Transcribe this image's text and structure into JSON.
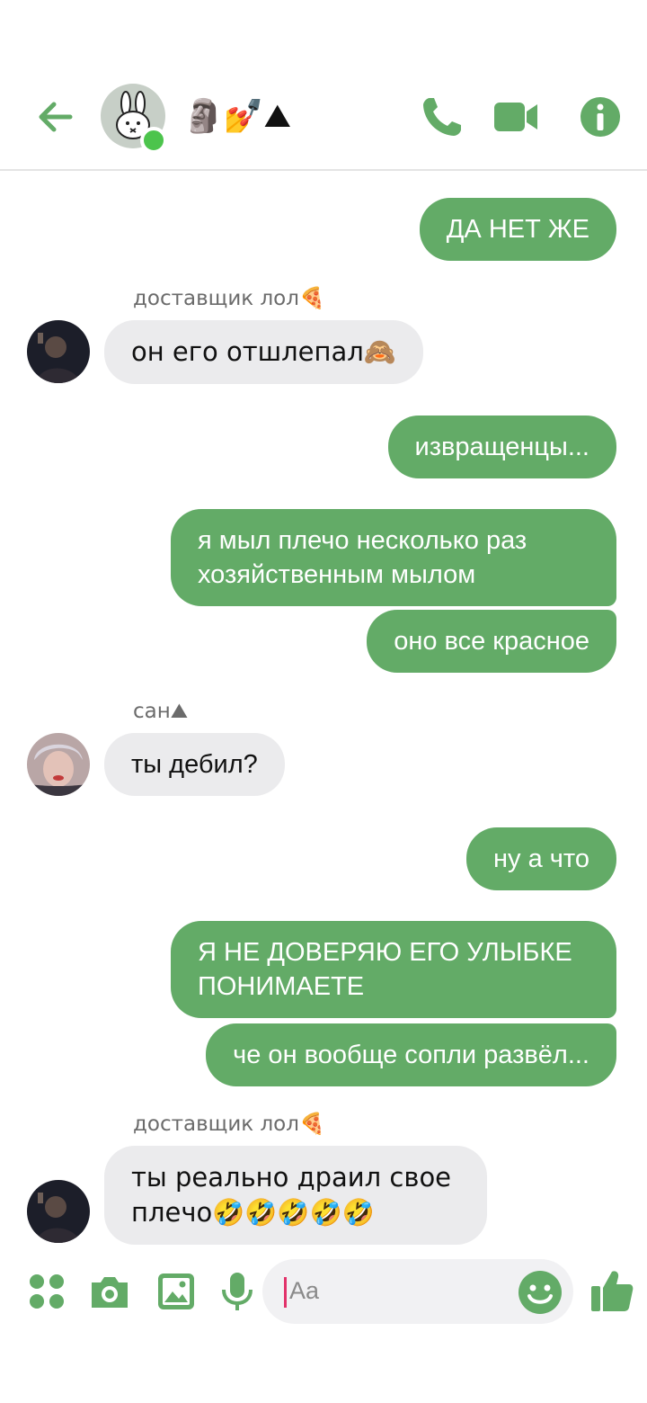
{
  "header": {
    "title_emojis": "🗿💅⛰",
    "icons": [
      "back-arrow-icon",
      "phone-icon",
      "video-camera-icon",
      "info-icon"
    ],
    "accent_color": "#63ab67"
  },
  "messages": [
    {
      "id": "m1",
      "side": "outgoing",
      "text": "ДА НЕТ ЖЕ"
    },
    {
      "id": "m2",
      "side": "incoming",
      "sender": "доставщик лол🍕",
      "text": "он его отшлепал🙈"
    },
    {
      "id": "m3",
      "side": "outgoing",
      "text": "извращенцы..."
    },
    {
      "id": "m4",
      "side": "outgoing",
      "text": "я мыл плечо несколько раз хозяйственным мылом"
    },
    {
      "id": "m5",
      "side": "outgoing",
      "text": "оно все красное"
    },
    {
      "id": "m6",
      "side": "incoming",
      "sender": "сан⛰",
      "text": "ты дебил?"
    },
    {
      "id": "m7",
      "side": "outgoing",
      "text": "ну а что"
    },
    {
      "id": "m8",
      "side": "outgoing",
      "text": "Я НЕ ДОВЕРЯЮ ЕГО УЛЫБКЕ ПОНИМАЕТЕ"
    },
    {
      "id": "m9",
      "side": "outgoing",
      "text": "че он вообще сопли развёл..."
    },
    {
      "id": "m10",
      "side": "incoming",
      "sender": "доставщик лол🍕",
      "text": "ты реально драил свое плечо🤣🤣🤣🤣🤣"
    }
  ],
  "composer": {
    "placeholder": "Aa",
    "icons": [
      "apps-grid-icon",
      "camera-icon",
      "image-icon",
      "microphone-icon",
      "emoji-icon",
      "thumbs-up-icon"
    ]
  }
}
